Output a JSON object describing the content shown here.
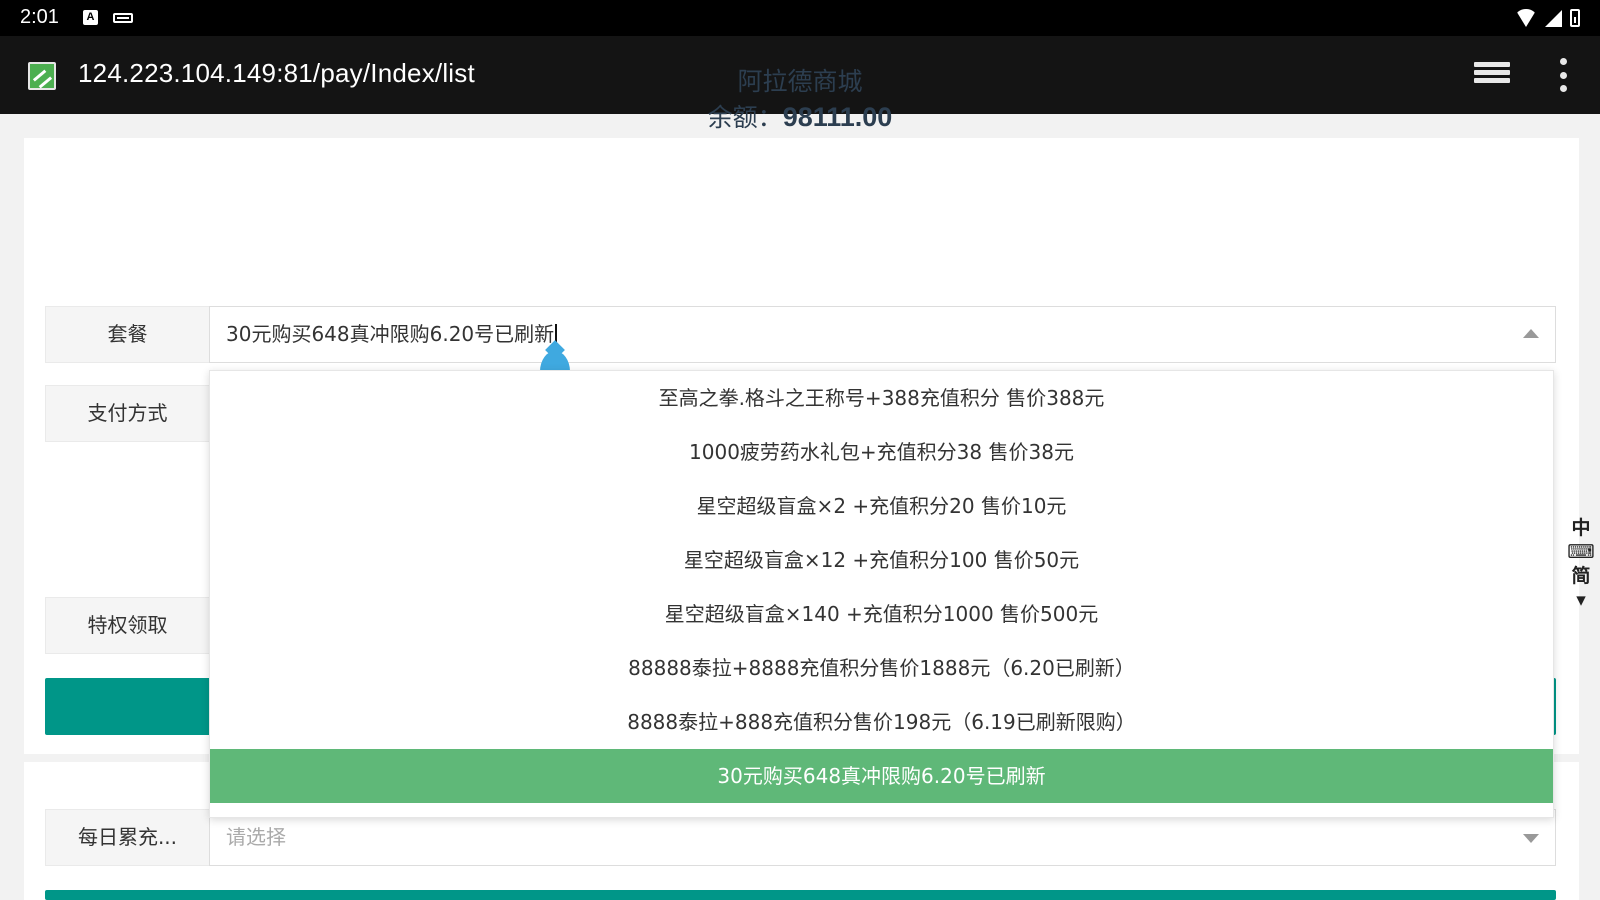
{
  "status_bar": {
    "time": "2:01",
    "icons": [
      "a-notification-icon",
      "keyboard-icon",
      "wifi-icon",
      "signal-icon",
      "battery-icon"
    ]
  },
  "browser": {
    "url": "124.223.104.149:81/pay/Index/list",
    "icons": [
      "site-favicon",
      "tabs-icon",
      "more-menu-icon"
    ]
  },
  "shop": {
    "title": "阿拉德商城",
    "balance_label": "余额：",
    "balance_value": "98111.00"
  },
  "form": {
    "package_label": "套餐",
    "package_value": "30元购买648真冲限购6.20号已刷新",
    "payment_label": "支付方式",
    "privilege_label": "特权领取",
    "daily_label": "每日累充...",
    "daily_placeholder": "请选择"
  },
  "dropdown": {
    "items": [
      "至高之拳.格斗之王称号+388充值积分 售价388元",
      "1000疲劳药水礼包+充值积分38 售价38元",
      "星空超级盲盒×2 +充值积分20 售价10元",
      "星空超级盲盒×12 +充值积分100 售价50元",
      "星空超级盲盒×140 +充值积分1000 售价500元",
      "88888泰拉+8888充值积分售价1888元（6.20已刷新）",
      "8888泰拉+888充值积分售价198元（6.19已刷新限购）",
      "30元购买648真冲限购6.20号已刷新"
    ],
    "selected_index": 7
  },
  "ime_tool": {
    "chars": [
      "中",
      "简"
    ]
  },
  "colors": {
    "teal": "#009688",
    "selected_green": "#5fb878",
    "title_text": "#2c3e50"
  }
}
